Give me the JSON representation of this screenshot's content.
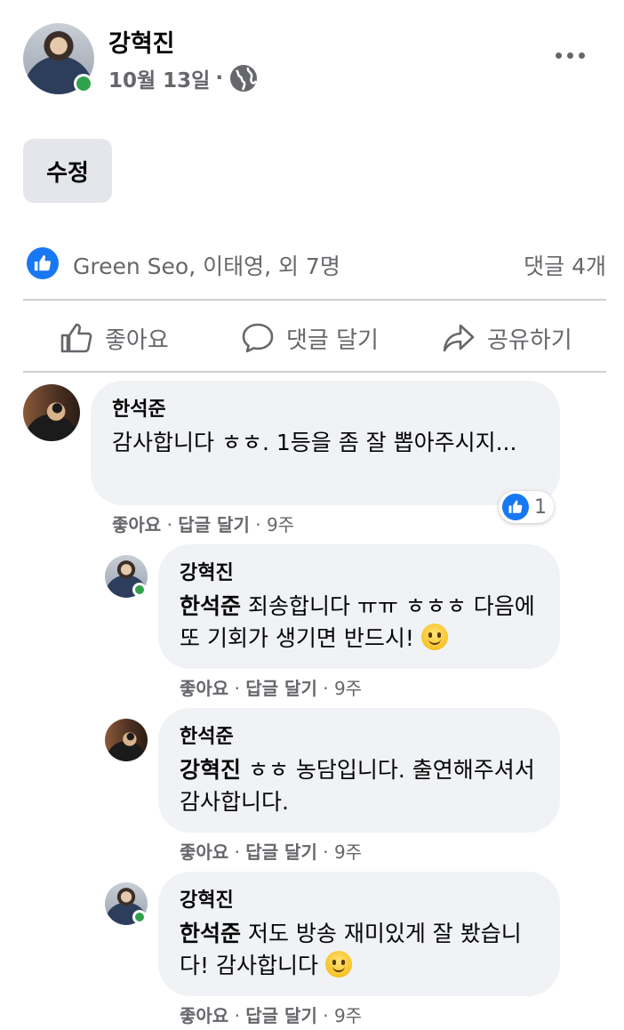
{
  "post": {
    "author": "강혁진",
    "date": "10월 13일",
    "date_sep": "·",
    "edit_label": "수정"
  },
  "reactions": {
    "summary": "Green Seo, 이태영, 외 7명",
    "comment_count": "댓글 4개"
  },
  "actions": {
    "like": "좋아요",
    "comment": "댓글 달기",
    "share": "공유하기"
  },
  "comments": [
    {
      "name": "한석준",
      "text": "감사합니다 ㅎㅎ. 1등을 좀 잘 뽑아주시지...",
      "like": "좋아요",
      "reply": "답글 달기",
      "time": "9주",
      "reaction_count": "1"
    },
    {
      "name": "강혁진",
      "mention": "한석준",
      "text": " 죄송합니다 ㅠㅠ ㅎㅎㅎ 다음에 또 기회가 생기면 반드시! ",
      "like": "좋아요",
      "reply": "답글 달기",
      "time": "9주"
    },
    {
      "name": "한석준",
      "mention": "강혁진",
      "text": " ㅎㅎ 농담입니다. 출연해주셔서 감사합니다.",
      "like": "좋아요",
      "reply": "답글 달기",
      "time": "9주"
    },
    {
      "name": "강혁진",
      "mention": "한석준",
      "text": " 저도 방송 재미있게 잘 봤습니다! 감사합니다 ",
      "like": "좋아요",
      "reply": "답글 달기",
      "time": "9주"
    }
  ],
  "meta_sep": "·",
  "icons": [
    "globe-icon",
    "more-icon",
    "like-icon",
    "comment-icon",
    "share-icon",
    "smile-emoji-icon"
  ],
  "colors": {
    "accent": "#1877f2",
    "online": "#31a24c",
    "muted": "#65676b",
    "bubble": "#f0f2f5"
  }
}
